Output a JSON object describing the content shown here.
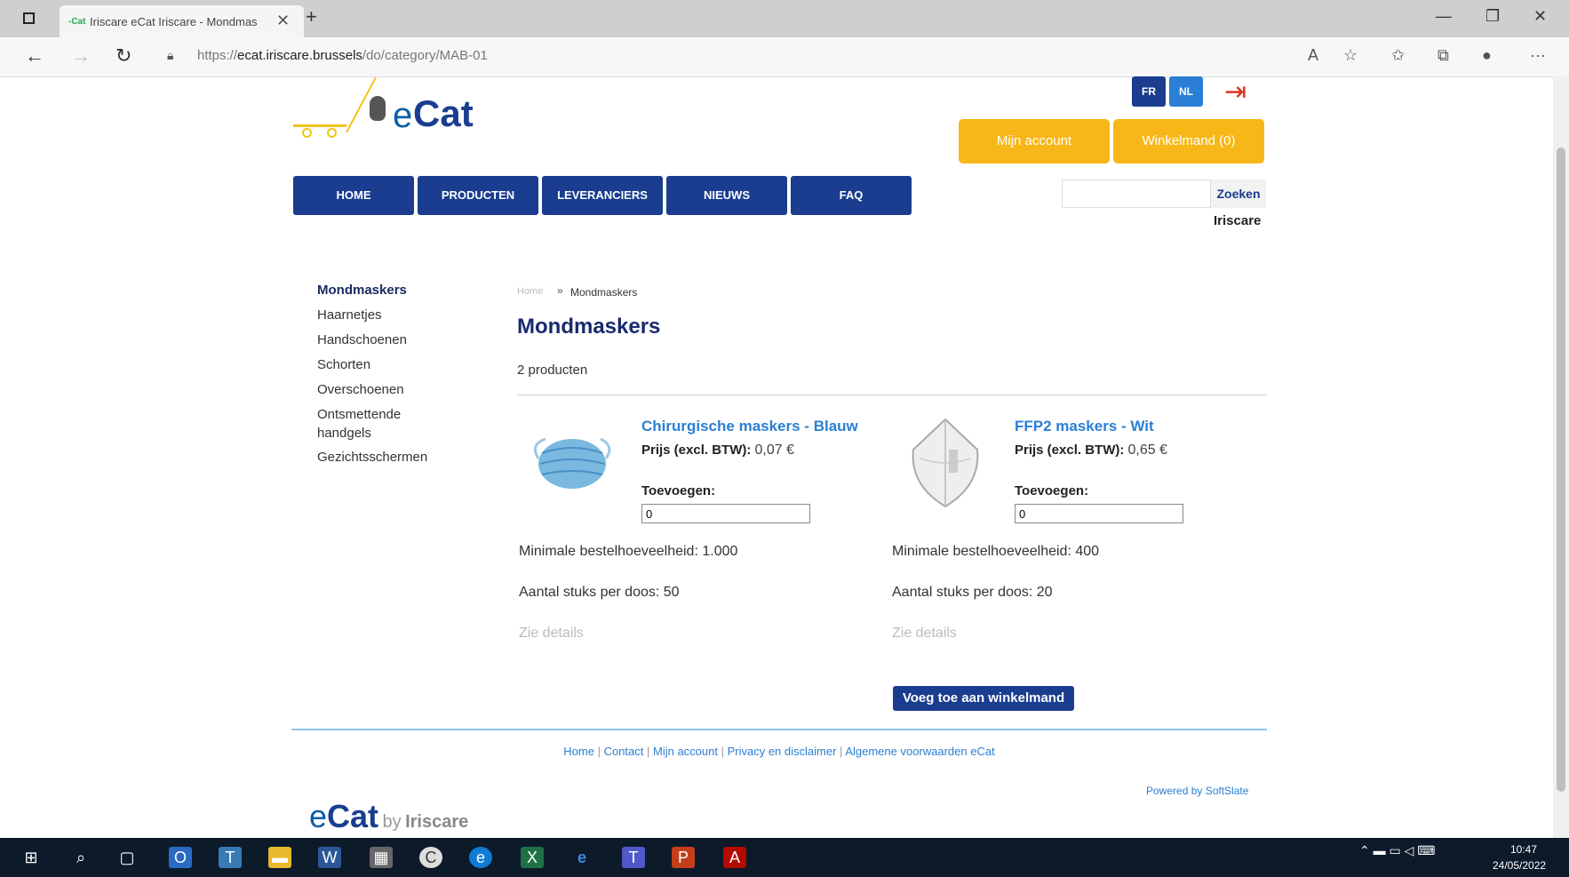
{
  "browser": {
    "tab_title": "Iriscare eCat Iriscare - Mondmas",
    "tab_favicon": "-Cat",
    "url_prefix": "https://",
    "url_domain": "ecat.iriscare.brussels",
    "url_path": "/do/category/MAB-01"
  },
  "header": {
    "logo_e": "e",
    "logo_cat": "Cat",
    "lang_fr": "FR",
    "lang_nl": "NL",
    "mijn_account": "Mijn account",
    "winkelmand": "Winkelmand (0)",
    "search_button": "Zoeken",
    "org_name": "Iriscare"
  },
  "nav": [
    {
      "label": "HOME"
    },
    {
      "label": "PRODUCTEN"
    },
    {
      "label": "LEVERANCIERS"
    },
    {
      "label": "NIEUWS"
    },
    {
      "label": "FAQ"
    }
  ],
  "sidebar": [
    {
      "label": "Mondmaskers"
    },
    {
      "label": "Haarnetjes"
    },
    {
      "label": "Handschoenen"
    },
    {
      "label": "Schorten"
    },
    {
      "label": "Overschoenen"
    },
    {
      "label": "Ontsmettende"
    },
    {
      "label": "handgels"
    },
    {
      "label": "Gezichtsschermen"
    }
  ],
  "main": {
    "breadcrumb_home": "Home",
    "breadcrumb_sep": "»",
    "breadcrumb_current": "Mondmaskers",
    "title": "Mondmaskers",
    "count": "2 producten",
    "price_label": "Prijs (excl. BTW):",
    "add_label": "Toevoegen:",
    "details_label": "Zie details",
    "add_to_cart": "Voeg toe aan winkelmand",
    "products": [
      {
        "name": "Chirurgische maskers - Blauw",
        "price": "0,07 €",
        "qty": "0",
        "min_order": "Minimale bestelhoeveelheid: 1.000",
        "per_box": "Aantal stuks per doos: 50"
      },
      {
        "name": "FFP2 maskers - Wit",
        "price": "0,65 €",
        "qty": "0",
        "min_order": "Minimale bestelhoeveelheid: 400",
        "per_box": "Aantal stuks per doos: 20"
      }
    ]
  },
  "footer": {
    "links": [
      "Home",
      "Contact",
      "Mijn account",
      "Privacy en disclaimer",
      "Algemene voorwaarden eCat"
    ],
    "powered": "Powered by SoftSlate",
    "logo_e": "e",
    "logo_cat": "Cat",
    "logo_by": "by",
    "logo_iris": "Iriscare"
  },
  "taskbar": {
    "time": "10:47",
    "date": "24/05/2022"
  }
}
